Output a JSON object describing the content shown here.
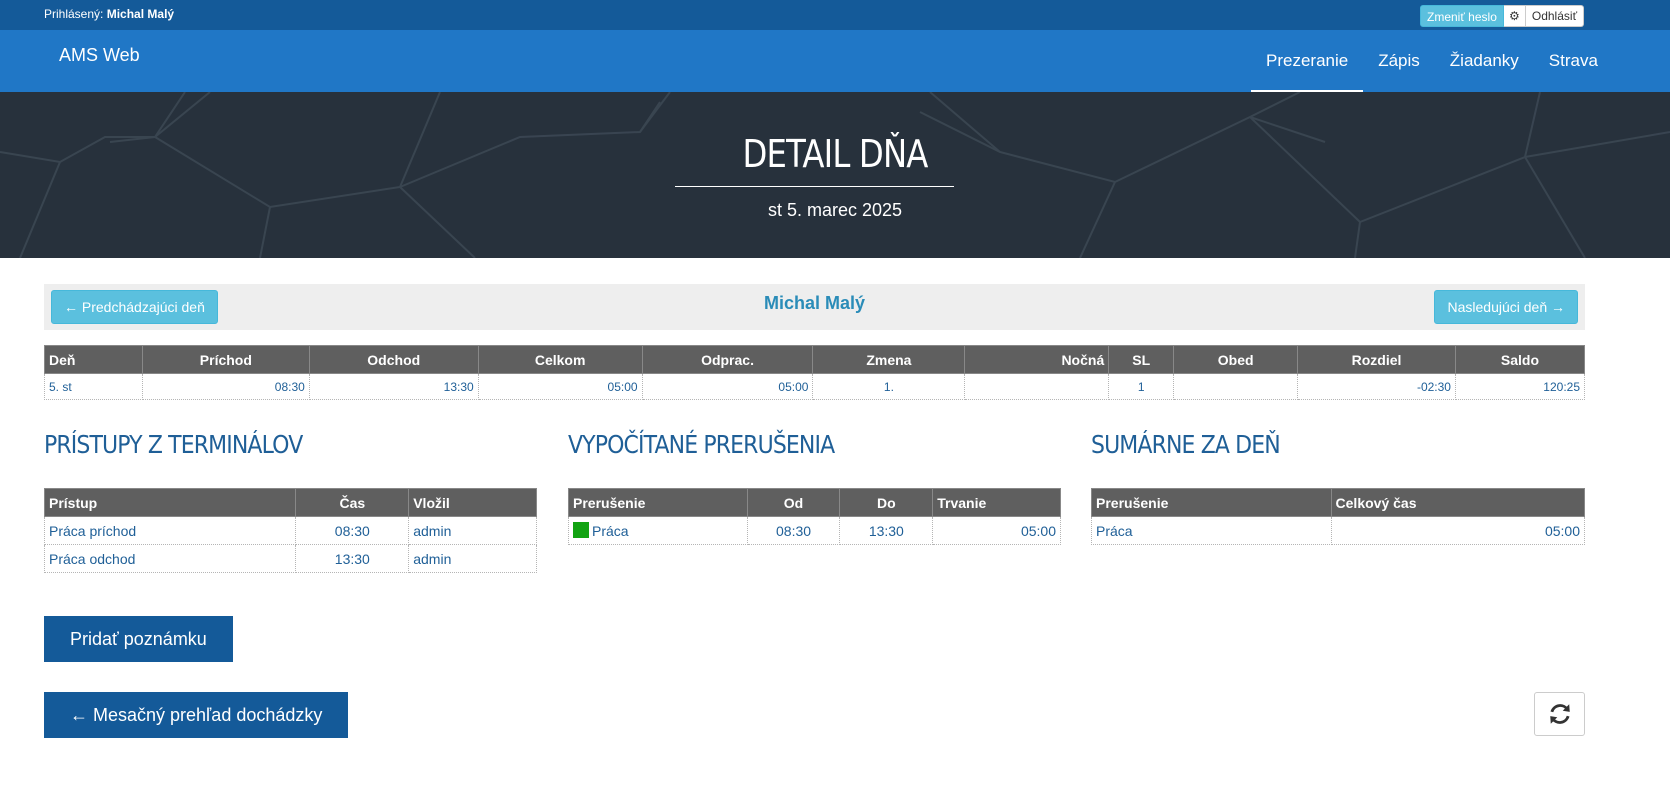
{
  "topbar": {
    "user_label": "Prihlásený:",
    "user_name": "Michal Malý",
    "change_password": "Zmeniť heslo",
    "logout": "Odhlásiť"
  },
  "navbar": {
    "brand": "AMS Web",
    "items": [
      {
        "label": "Prezeranie",
        "active": true
      },
      {
        "label": "Zápis"
      },
      {
        "label": "Žiadanky"
      },
      {
        "label": "Strava"
      }
    ]
  },
  "hero": {
    "title": "DETAIL DŇA",
    "date": "st 5. marec 2025"
  },
  "daybar": {
    "prev": "← Predchádzajúci deň",
    "name": "Michal Malý",
    "next": "Nasledujúci deň →"
  },
  "day_table": {
    "headers": [
      "Deň",
      "Príchod",
      "Odchod",
      "Celkom",
      "Odprac.",
      "Zmena",
      "Nočná",
      "SL",
      "Obed",
      "Rozdiel",
      "Saldo"
    ],
    "row": [
      "5. st",
      "08:30",
      "13:30",
      "05:00",
      "05:00",
      "1.",
      "",
      "1",
      "",
      "-02:30",
      "120:25"
    ]
  },
  "sections": {
    "access": "PRÍSTUPY Z TERMINÁLOV",
    "breaks": "VYPOČÍTANÉ PRERUŠENIA",
    "summary": "SUMÁRNE ZA DEŇ"
  },
  "access_table": {
    "headers": [
      "Prístup",
      "Čas",
      "Vložil"
    ],
    "rows": [
      [
        "Práca príchod",
        "08:30",
        "admin"
      ],
      [
        "Práca odchod",
        "13:30",
        "admin"
      ]
    ]
  },
  "breaks_table": {
    "headers": [
      "Prerušenie",
      "Od",
      "Do",
      "Trvanie"
    ],
    "rows": [
      [
        "Práca",
        "08:30",
        "13:30",
        "05:00"
      ]
    ],
    "color": "#12a312"
  },
  "summary_table": {
    "headers": [
      "Prerušenie",
      "Celkový čas"
    ],
    "rows": [
      [
        "Práca",
        "05:00"
      ]
    ]
  },
  "buttons": {
    "add_note": "Pridať poznámku",
    "monthly": "← Mesačný prehľad dochádzky"
  },
  "icons": {
    "settings": "gear-icon",
    "refresh": "refresh-icon"
  }
}
